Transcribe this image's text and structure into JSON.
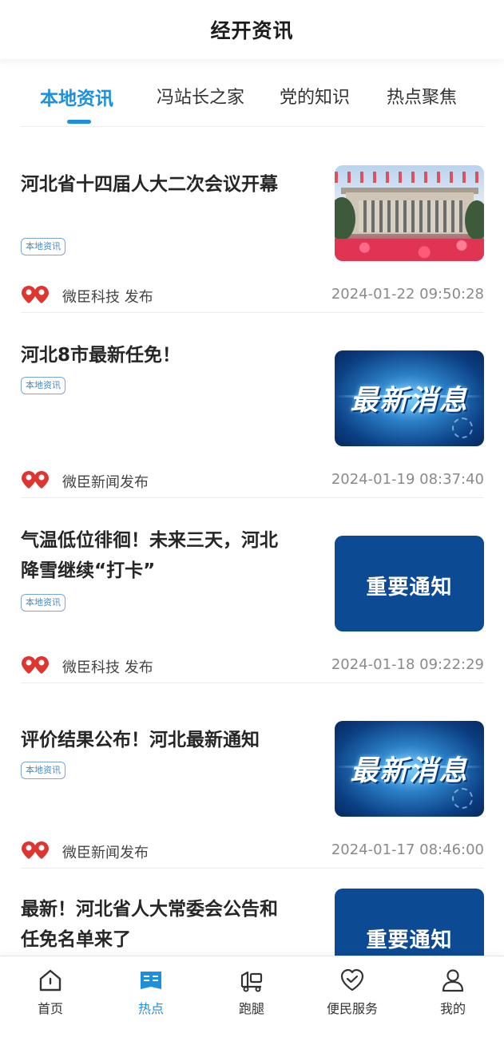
{
  "header": {
    "title": "经开资讯"
  },
  "tabs": [
    {
      "label": "本地资讯",
      "active": true
    },
    {
      "label": "冯站长之家",
      "active": false
    },
    {
      "label": "党的知识",
      "active": false
    },
    {
      "label": "热点聚焦",
      "active": false
    }
  ],
  "articles": [
    {
      "title": "河北省十四届人大二次会议开幕",
      "badge": "本地资讯",
      "publisher": "微臣科技 发布",
      "date": "2024-01-22 09:50:28",
      "thumb": "photo-great-hall"
    },
    {
      "title": "河北8市最新任免！",
      "badge": "本地资讯",
      "publisher": "微臣新闻发布",
      "date": "2024-01-19 08:37:40",
      "thumb": "banner-latest-news",
      "thumb_text": "最新消息"
    },
    {
      "title": "气温低位徘徊！未来三天，河北降雪继续“打卡”",
      "badge": "本地资讯",
      "publisher": "微臣科技 发布",
      "date": "2024-01-18 09:22:29",
      "thumb": "banner-important-notice",
      "thumb_text": "重要通知"
    },
    {
      "title": "评价结果公布！河北最新通知",
      "badge": "本地资讯",
      "publisher": "微臣新闻发布",
      "date": "2024-01-17 08:46:00",
      "thumb": "banner-latest-news",
      "thumb_text": "最新消息"
    },
    {
      "title": "最新！河北省人大常委会公告和任免名单来了",
      "thumb": "banner-important-notice",
      "thumb_text": "重要通知"
    }
  ],
  "bottom_nav": [
    {
      "label": "首页",
      "icon": "home-icon",
      "active": false
    },
    {
      "label": "热点",
      "icon": "news-icon",
      "active": true
    },
    {
      "label": "跑腿",
      "icon": "delivery-icon",
      "active": false
    },
    {
      "label": "便民服务",
      "icon": "heart-check-icon",
      "active": false
    },
    {
      "label": "我的",
      "icon": "user-icon",
      "active": false
    }
  ],
  "colors": {
    "accent": "#1d8fe0",
    "brand_red": "#e0342f",
    "badge_border": "#7aa6d6"
  }
}
